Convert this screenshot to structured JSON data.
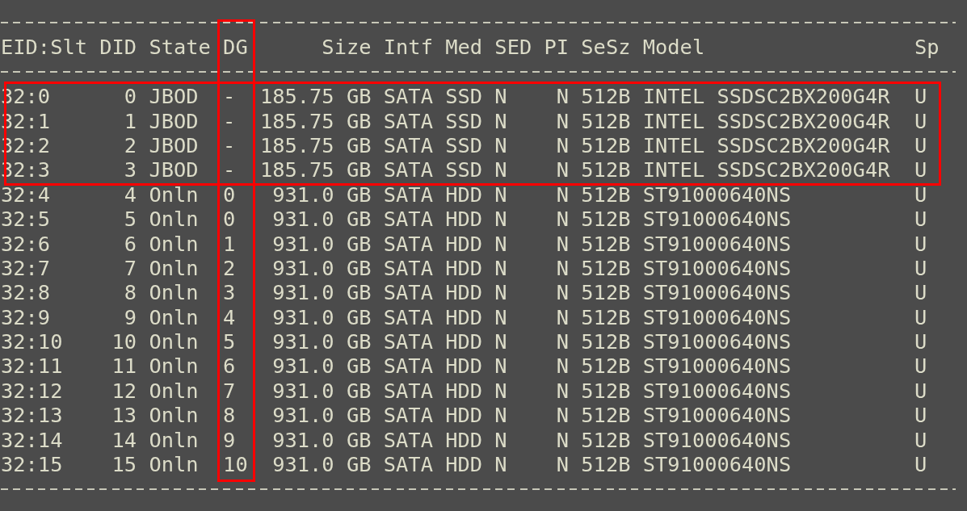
{
  "table": {
    "columns": [
      {
        "label": "EID:Slt",
        "highlighted": false
      },
      {
        "label": "DID",
        "highlighted": false
      },
      {
        "label": "State",
        "highlighted": false
      },
      {
        "label": "DG",
        "highlighted": true
      },
      {
        "label": "Size",
        "highlighted": false
      },
      {
        "label": "Intf",
        "highlighted": false
      },
      {
        "label": "Med",
        "highlighted": false
      },
      {
        "label": "SED",
        "highlighted": false
      },
      {
        "label": "PI",
        "highlighted": false
      },
      {
        "label": "SeSz",
        "highlighted": false
      },
      {
        "label": "Model",
        "highlighted": false
      },
      {
        "label": "Sp",
        "highlighted": false
      }
    ],
    "rows": [
      {
        "cells": [
          "32:0",
          "0",
          "JBOD",
          "-",
          "185.75 GB",
          "SATA",
          "SSD",
          "N",
          "N",
          "512B",
          "INTEL SSDSC2BX200G4R",
          "U"
        ],
        "highlighted": true
      },
      {
        "cells": [
          "32:1",
          "1",
          "JBOD",
          "-",
          "185.75 GB",
          "SATA",
          "SSD",
          "N",
          "N",
          "512B",
          "INTEL SSDSC2BX200G4R",
          "U"
        ],
        "highlighted": true
      },
      {
        "cells": [
          "32:2",
          "2",
          "JBOD",
          "-",
          "185.75 GB",
          "SATA",
          "SSD",
          "N",
          "N",
          "512B",
          "INTEL SSDSC2BX200G4R",
          "U"
        ],
        "highlighted": true
      },
      {
        "cells": [
          "32:3",
          "3",
          "JBOD",
          "-",
          "185.75 GB",
          "SATA",
          "SSD",
          "N",
          "N",
          "512B",
          "INTEL SSDSC2BX200G4R",
          "U"
        ],
        "highlighted": true
      },
      {
        "cells": [
          "32:4",
          "4",
          "Onln",
          "0",
          "931.0 GB",
          "SATA",
          "HDD",
          "N",
          "N",
          "512B",
          "ST91000640NS",
          "U"
        ],
        "highlighted": false
      },
      {
        "cells": [
          "32:5",
          "5",
          "Onln",
          "0",
          "931.0 GB",
          "SATA",
          "HDD",
          "N",
          "N",
          "512B",
          "ST91000640NS",
          "U"
        ],
        "highlighted": false
      },
      {
        "cells": [
          "32:6",
          "6",
          "Onln",
          "1",
          "931.0 GB",
          "SATA",
          "HDD",
          "N",
          "N",
          "512B",
          "ST91000640NS",
          "U"
        ],
        "highlighted": false
      },
      {
        "cells": [
          "32:7",
          "7",
          "Onln",
          "2",
          "931.0 GB",
          "SATA",
          "HDD",
          "N",
          "N",
          "512B",
          "ST91000640NS",
          "U"
        ],
        "highlighted": false
      },
      {
        "cells": [
          "32:8",
          "8",
          "Onln",
          "3",
          "931.0 GB",
          "SATA",
          "HDD",
          "N",
          "N",
          "512B",
          "ST91000640NS",
          "U"
        ],
        "highlighted": false
      },
      {
        "cells": [
          "32:9",
          "9",
          "Onln",
          "4",
          "931.0 GB",
          "SATA",
          "HDD",
          "N",
          "N",
          "512B",
          "ST91000640NS",
          "U"
        ],
        "highlighted": false
      },
      {
        "cells": [
          "32:10",
          "10",
          "Onln",
          "5",
          "931.0 GB",
          "SATA",
          "HDD",
          "N",
          "N",
          "512B",
          "ST91000640NS",
          "U"
        ],
        "highlighted": false
      },
      {
        "cells": [
          "32:11",
          "11",
          "Onln",
          "6",
          "931.0 GB",
          "SATA",
          "HDD",
          "N",
          "N",
          "512B",
          "ST91000640NS",
          "U"
        ],
        "highlighted": false
      },
      {
        "cells": [
          "32:12",
          "12",
          "Onln",
          "7",
          "931.0 GB",
          "SATA",
          "HDD",
          "N",
          "N",
          "512B",
          "ST91000640NS",
          "U"
        ],
        "highlighted": false
      },
      {
        "cells": [
          "32:13",
          "13",
          "Onln",
          "8",
          "931.0 GB",
          "SATA",
          "HDD",
          "N",
          "N",
          "512B",
          "ST91000640NS",
          "U"
        ],
        "highlighted": false
      },
      {
        "cells": [
          "32:14",
          "14",
          "Onln",
          "9",
          "931.0 GB",
          "SATA",
          "HDD",
          "N",
          "N",
          "512B",
          "ST91000640NS",
          "U"
        ],
        "highlighted": false
      },
      {
        "cells": [
          "32:15",
          "15",
          "Onln",
          "10",
          "931.0 GB",
          "SATA",
          "HDD",
          "N",
          "N",
          "512B",
          "ST91000640NS",
          "U"
        ],
        "highlighted": false
      }
    ]
  }
}
